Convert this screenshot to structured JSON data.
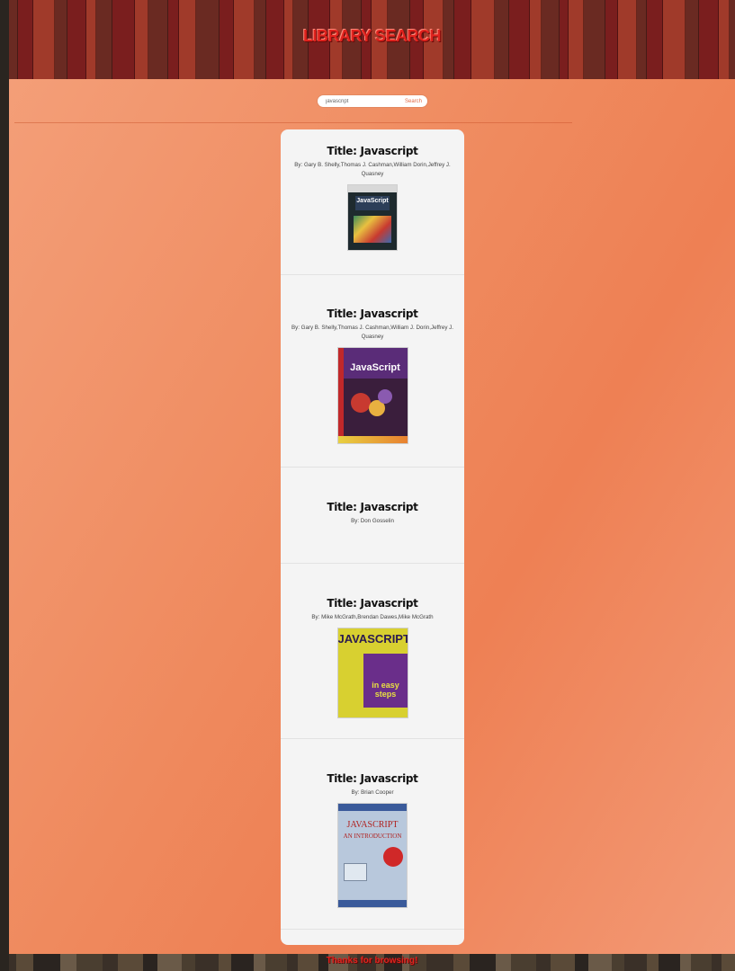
{
  "header": {
    "title": "LIBRARY SEARCH"
  },
  "search": {
    "value": "javascript",
    "button_label": "Search"
  },
  "results": [
    {
      "title": "Title: Javascript",
      "authors": "By: Gary B. Shelly,Thomas J. Cashman,William Dorin,Jeffrey J. Quasney",
      "cover_text": "JavaScript"
    },
    {
      "title": "Title: Javascript",
      "authors": "By: Gary B. Shelly,Thomas J. Cashman,William J. Dorin,Jeffrey J. Quasney",
      "cover_text": "JavaScript"
    },
    {
      "title": "Title: Javascript",
      "authors": "By: Don Gosselin"
    },
    {
      "title": "Title: Javascript",
      "authors": "By: Mike McGrath,Brendan Dawes,Mike McGrath",
      "cover_text": "JAVASCRIPT",
      "cover_subtext": "in easy steps"
    },
    {
      "title": "Title: Javascript",
      "authors": "By: Brian Cooper",
      "cover_text": "JAVASCRIPT",
      "cover_subtext": "AN INTRODUCTION"
    }
  ],
  "footer": {
    "text": "Thanks for browsing!"
  },
  "colors": {
    "accent": "#e0231e",
    "background": "#ef8a5e",
    "card": "#f4f4f4"
  }
}
